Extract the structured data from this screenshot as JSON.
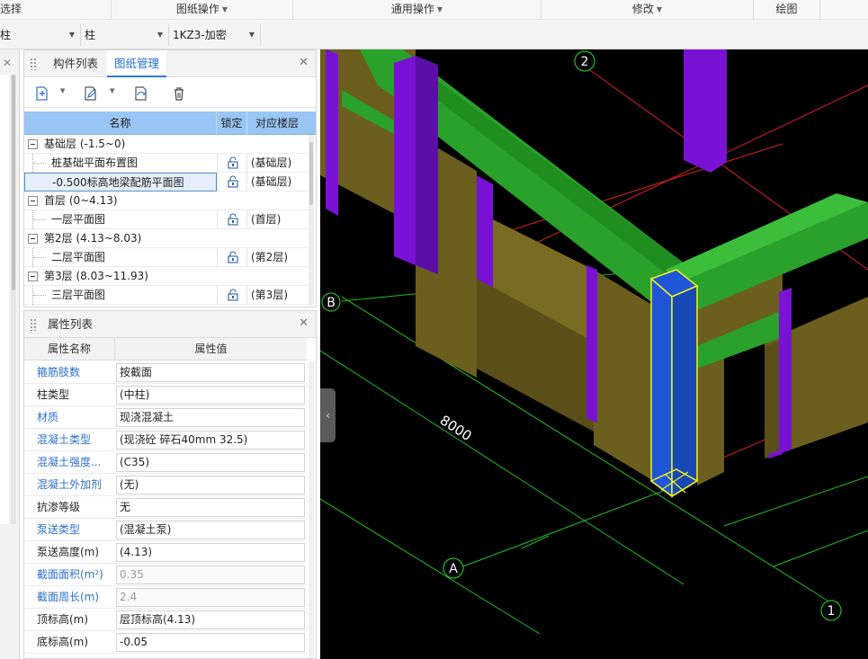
{
  "ribbon": {
    "groups": [
      {
        "label": "选择",
        "caret": false
      },
      {
        "label": "图纸操作",
        "caret": true
      },
      {
        "label": "通用操作",
        "caret": true
      },
      {
        "label": "修改",
        "caret": true
      },
      {
        "label": "绘图",
        "caret": false
      }
    ]
  },
  "selectors": {
    "floor": "柱",
    "type": "柱",
    "component": "1KZ3-加密"
  },
  "drawing_panel": {
    "tabs": [
      "构件列表",
      "图纸管理"
    ],
    "active_tab": "图纸管理",
    "columns": {
      "name": "名称",
      "lock": "锁定",
      "floor": "对应楼层"
    },
    "rows": [
      {
        "kind": "group",
        "name": "基础层 (-1.5~0)",
        "floor": ""
      },
      {
        "kind": "item",
        "name": "桩基础平面布置图",
        "floor": "(基础层)"
      },
      {
        "kind": "item",
        "name": "-0.500标高地梁配筋平面图",
        "floor": "(基础层)",
        "selected": true
      },
      {
        "kind": "group",
        "name": "首层 (0~4.13)",
        "floor": ""
      },
      {
        "kind": "item",
        "name": "一层平面图",
        "floor": "(首层)"
      },
      {
        "kind": "group",
        "name": "第2层 (4.13~8.03)",
        "floor": ""
      },
      {
        "kind": "item",
        "name": "二层平面图",
        "floor": "(第2层)"
      },
      {
        "kind": "group",
        "name": "第3层 (8.03~11.93)",
        "floor": ""
      },
      {
        "kind": "item",
        "name": "三层平面图",
        "floor": "(第3层)"
      }
    ]
  },
  "property_panel": {
    "title": "属性列表",
    "col_name": "属性名称",
    "col_value": "属性值",
    "rows": [
      {
        "name": "箍筋肢数",
        "value": "按截面",
        "blue": true,
        "gray": false
      },
      {
        "name": "柱类型",
        "value": "(中柱)",
        "blue": false,
        "gray": false
      },
      {
        "name": "材质",
        "value": "现浇混凝土",
        "blue": true,
        "gray": false
      },
      {
        "name": "混凝土类型",
        "value": "(现浇砼 碎石40mm 32.5)",
        "blue": true,
        "gray": false
      },
      {
        "name": "混凝土强度...",
        "value": "(C35)",
        "blue": true,
        "gray": false
      },
      {
        "name": "混凝土外加剂",
        "value": "(无)",
        "blue": true,
        "gray": false
      },
      {
        "name": "抗渗等级",
        "value": "无",
        "blue": false,
        "gray": false
      },
      {
        "name": "泵送类型",
        "value": "(混凝土泵)",
        "blue": true,
        "gray": false
      },
      {
        "name": "泵送高度(m)",
        "value": "(4.13)",
        "blue": false,
        "gray": false
      },
      {
        "name": "截面面积(m²)",
        "value": "0.35",
        "blue": true,
        "gray": true
      },
      {
        "name": "截面周长(m)",
        "value": "2.4",
        "blue": true,
        "gray": true
      },
      {
        "name": "顶标高(m)",
        "value": "层顶标高(4.13)",
        "blue": false,
        "gray": false
      },
      {
        "name": "底标高(m)",
        "value": "-0.05",
        "blue": false,
        "gray": false
      }
    ]
  },
  "viewport": {
    "axis_labels": {
      "a": "A",
      "b": "B",
      "one": "1",
      "two": "2"
    },
    "dimension": "8000",
    "colors": {
      "beam": "#2aa12a",
      "column": "#1f56d8",
      "wall": "#6b5e1e",
      "constructional_column": "#7a12d6",
      "highlight": "#f2f21a",
      "grid": "#1fbf1f",
      "axis_red": "#e02020"
    }
  }
}
